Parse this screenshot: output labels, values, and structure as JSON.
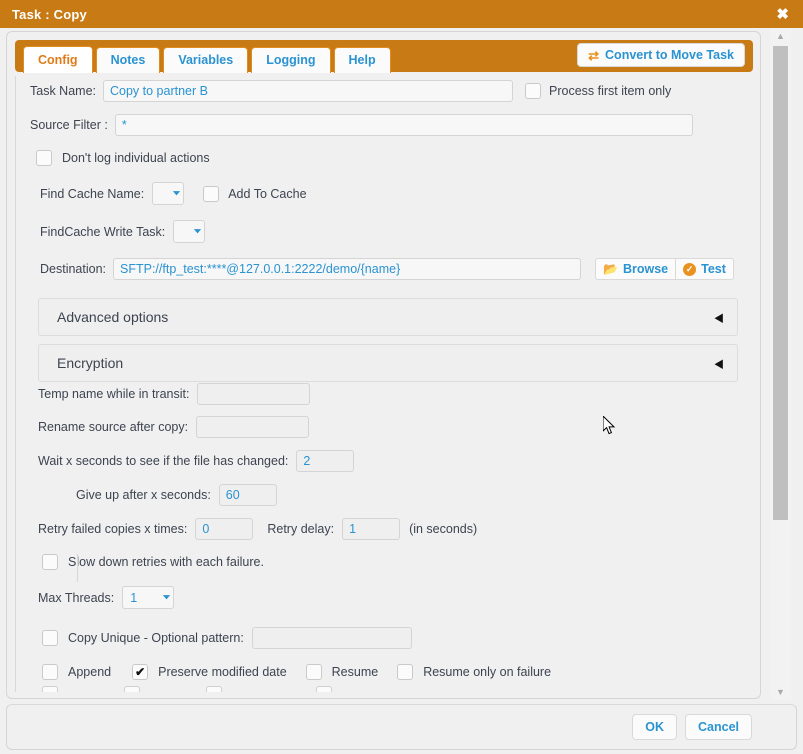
{
  "window": {
    "title": "Task : Copy",
    "close_icon": "close-icon",
    "accent_color": "#c87a14",
    "link_color": "#2a93d1",
    "active_tab_color": "#e07c18"
  },
  "tabs": [
    {
      "label": "Config",
      "active": true
    },
    {
      "label": "Notes",
      "active": false
    },
    {
      "label": "Variables",
      "active": false
    },
    {
      "label": "Logging",
      "active": false
    },
    {
      "label": "Help",
      "active": false
    }
  ],
  "toolbar": {
    "convert_label": "Convert to Move Task",
    "convert_icon": "swap-arrows-icon"
  },
  "form": {
    "task_name_label": "Task Name:",
    "task_name_value": "Copy to partner B",
    "process_first_item_label": "Process first item only",
    "process_first_item_checked": false,
    "source_filter_label": "Source Filter :",
    "source_filter_value": "*",
    "dont_log_label": "Don't log individual actions",
    "dont_log_checked": false,
    "find_cache_name_label": "Find Cache Name:",
    "find_cache_name_value": "",
    "add_to_cache_label": "Add To Cache",
    "add_to_cache_checked": false,
    "findcache_write_task_label": "FindCache Write Task:",
    "findcache_write_task_value": "",
    "destination_label": "Destination:",
    "destination_value": "SFTP://ftp_test:****@127.0.0.1:2222/demo/{name}",
    "browse_label": "Browse",
    "browse_icon": "folder-open-icon",
    "test_label": "Test",
    "test_icon": "check-circle-icon",
    "advanced_options_label": "Advanced options",
    "encryption_label": "Encryption",
    "collapse_arrow_icon": "triangle-left-icon",
    "temp_name_label": "Temp name while in transit:",
    "temp_name_value": "",
    "rename_source_label": "Rename source after copy:",
    "rename_source_value": "",
    "wait_seconds_label": "Wait x seconds to see if the file has changed:",
    "wait_seconds_value": "2",
    "give_up_label": "Give up after x seconds:",
    "give_up_value": "60",
    "retry_failed_label": "Retry failed copies x times:",
    "retry_failed_value": "0",
    "retry_delay_label": "Retry delay:",
    "retry_delay_value": "1",
    "retry_delay_suffix": "(in seconds)",
    "slow_down_label": "Slow down retries with each failure.",
    "slow_down_checked": false,
    "max_threads_label": "Max Threads:",
    "max_threads_value": "1",
    "copy_unique_label": "Copy Unique - Optional pattern:",
    "copy_unique_checked": false,
    "copy_unique_pattern": "",
    "append_label": "Append",
    "append_checked": false,
    "preserve_modified_label": "Preserve modified date",
    "preserve_modified_checked": true,
    "preserve_modified_tick": "✔",
    "resume_label": "Resume",
    "resume_checked": false,
    "resume_only_failure_label": "Resume only on failure",
    "resume_only_failure_checked": false
  },
  "scrollbar": {
    "up_arrow_icon": "triangle-up-icon",
    "down_arrow_icon": "triangle-down-icon"
  },
  "footer": {
    "ok_label": "OK",
    "cancel_label": "Cancel"
  }
}
